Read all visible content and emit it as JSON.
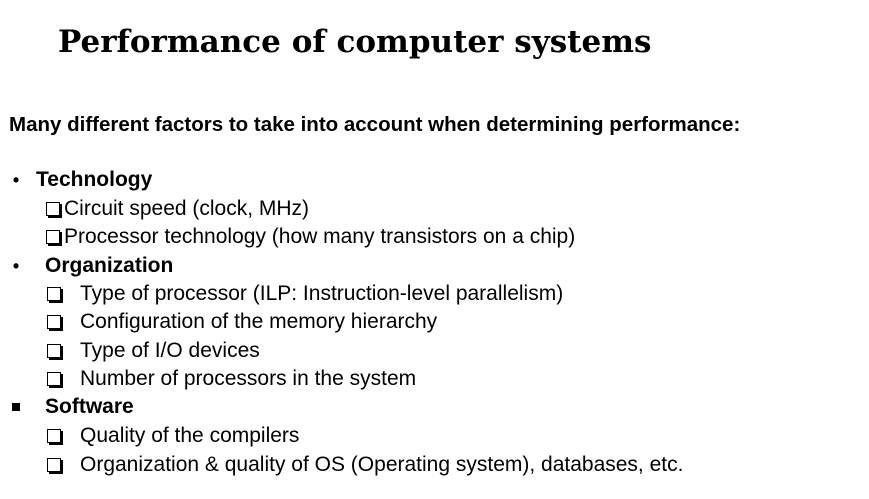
{
  "title": "Performance of computer systems",
  "intro": "Many different factors to take into account when determining performance:",
  "sections": [
    {
      "bullet": "•",
      "label": "Technology",
      "items": [
        "Circuit speed (clock, MHz)",
        "Processor technology (how many transistors on a chip)"
      ]
    },
    {
      "bullet": "•",
      "label": "Organization",
      "items": [
        "Type of processor (ILP: Instruction-level parallelism)",
        "Configuration of the memory hierarchy",
        "Type of I/O devices",
        "Number of processors in the system"
      ]
    },
    {
      "bullet": "▪",
      "label": "Software",
      "items": [
        "Quality of the compilers",
        "Organization & quality of OS (Operating system), databases, etc."
      ]
    }
  ]
}
